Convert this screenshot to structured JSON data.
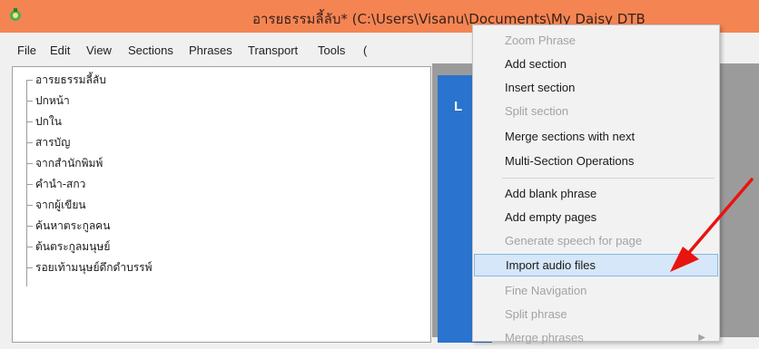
{
  "window": {
    "title": "อารยธรรมลี้ลับ* (C:\\Users\\Visanu\\Documents\\My Daisy DTB",
    "accent": "#f48553"
  },
  "menubar": {
    "items": [
      "File",
      "Edit",
      "View",
      "Sections",
      "Phrases",
      "Transport",
      "Tools",
      "("
    ]
  },
  "tree": {
    "items": [
      "อารยธรรมลี้ลับ",
      "ปกหน้า",
      "ปกใน",
      "สารบัญ",
      "จากสำนักพิมพ์",
      "คำนำ-สกว",
      "จากผู้เขียน",
      "ค้นหาตระกูลคน",
      "ต้นตระกูลมนุษย์",
      "รอยเท้ามนุษย์ดึกดำบรรพ์"
    ]
  },
  "blue_strip": {
    "letter": "L"
  },
  "context_menu": {
    "items": [
      {
        "label": "Zoom Phrase",
        "disabled": true
      },
      {
        "label": "Add section",
        "disabled": false
      },
      {
        "label": "Insert section",
        "disabled": false
      },
      {
        "label": "Split section",
        "disabled": true
      },
      {
        "label": "Merge sections with next",
        "disabled": false
      },
      {
        "label": "Multi-Section Operations",
        "disabled": false
      },
      {
        "label": "Add blank phrase",
        "disabled": false
      },
      {
        "label": "Add empty pages",
        "disabled": false
      },
      {
        "label": "Generate speech for page",
        "disabled": true
      },
      {
        "label": "Import audio files",
        "disabled": false,
        "highlighted": true
      },
      {
        "label": "Fine Navigation",
        "disabled": true
      },
      {
        "label": "Split phrase",
        "disabled": true
      },
      {
        "label": "Merge phrases",
        "disabled": true
      }
    ]
  },
  "annotation": {
    "color": "#e8140f"
  }
}
